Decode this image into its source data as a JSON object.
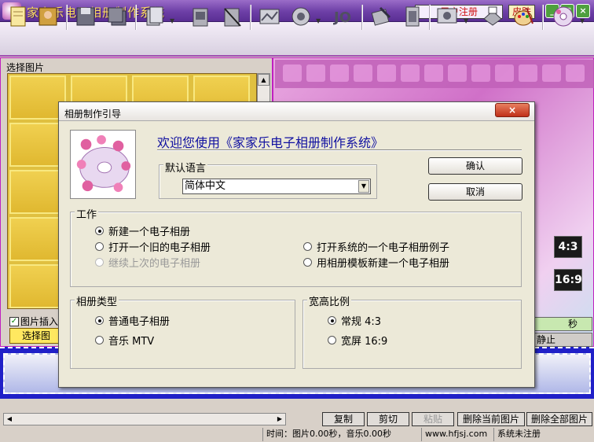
{
  "app": {
    "title": "家家乐电子相册制作系统",
    "register_label": "用户注册",
    "skin_label": "皮肤",
    "min_glyph": "_",
    "max_glyph": "□",
    "close_glyph": "×"
  },
  "left_panel": {
    "select_pictures_label": "选择图片",
    "insert_label": "图片插入",
    "select_button": "选择图"
  },
  "preview": {
    "ratio_43": "4:3",
    "ratio_169": "16:9",
    "seconds_label": "秒",
    "stop_label": "静止"
  },
  "bottom": {
    "buttons": [
      "复制",
      "剪切",
      "粘贴",
      "删除当前图片",
      "删除全部图片"
    ],
    "status_time": "时间：图片0.00秒，音乐0.00秒",
    "status_site": "www.hfjsj.com",
    "status_reg": "系统未注册"
  },
  "dialog": {
    "title": "相册制作引导",
    "welcome": "欢迎您使用《家家乐电子相册制作系统》",
    "language_group": "默认语言",
    "language_value": "简体中文",
    "ok_label": "确认",
    "cancel_label": "取消",
    "work_group": "工作",
    "work_options": [
      {
        "label": "新建一个电子相册",
        "selected": true,
        "enabled": true
      },
      {
        "label": "打开一个旧的电子相册",
        "selected": false,
        "enabled": true
      },
      {
        "label": "继续上次的电子相册",
        "selected": false,
        "enabled": false
      },
      {
        "label": "打开系统的一个电子相册例子",
        "selected": false,
        "enabled": true
      },
      {
        "label": "用相册模板新建一个电子相册",
        "selected": false,
        "enabled": true
      }
    ],
    "type_group": "相册类型",
    "type_options": [
      {
        "label": "普通电子相册",
        "selected": true
      },
      {
        "label": "音乐 MTV",
        "selected": false
      }
    ],
    "ratio_group": "宽高比例",
    "ratio_options": [
      {
        "label": "常规 4:3",
        "selected": true
      },
      {
        "label": "宽屏 16:9",
        "selected": false
      }
    ]
  },
  "colors": {
    "title_bar": "#6d3fa6",
    "accent": "#c020c0",
    "timeline": "#2020c8",
    "welcome_text": "#1010a0"
  }
}
